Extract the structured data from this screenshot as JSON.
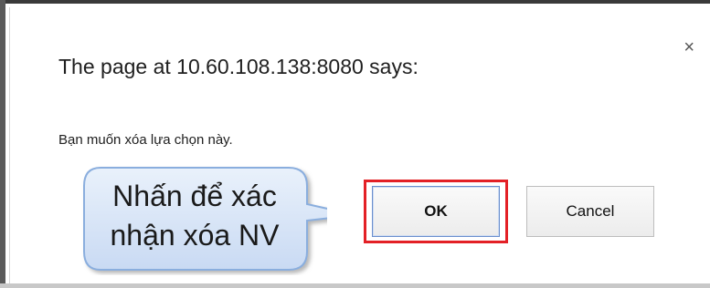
{
  "dialog": {
    "title": "The page at 10.60.108.138:8080 says:",
    "message": "Bạn muốn xóa lựa chọn này.",
    "close_label": "×",
    "ok_label": "OK",
    "cancel_label": "Cancel"
  },
  "callout": {
    "line1": "Nhấn để xác",
    "line2": "nhận xóa NV"
  },
  "colors": {
    "highlight": "#e32026",
    "callout_fill": "#d6e4f7",
    "callout_border": "#8aaede"
  }
}
